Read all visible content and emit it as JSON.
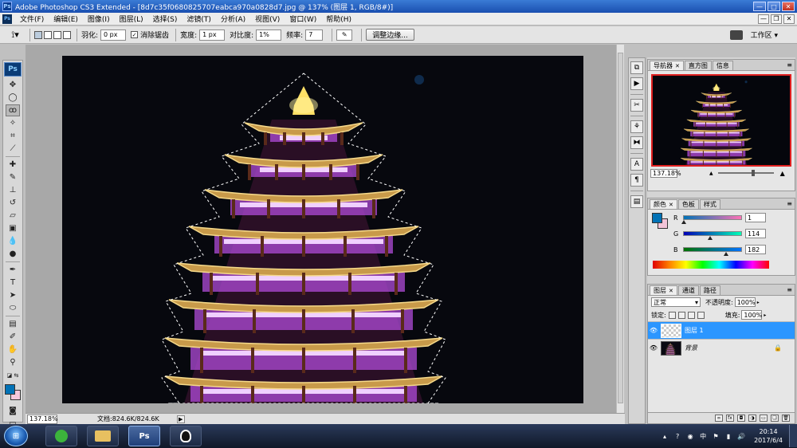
{
  "window": {
    "app_icon": "Ps",
    "title": "Adobe Photoshop CS3 Extended - [8d7c35f0680825707eabca970a0828d7.jpg @ 137% (图层 1, RGB/8#)]",
    "controls": {
      "minimize": "—",
      "maximize": "□",
      "close": "✕"
    }
  },
  "menu": {
    "items": [
      "文件(F)",
      "编辑(E)",
      "图像(I)",
      "图层(L)",
      "选择(S)",
      "滤镜(T)",
      "分析(A)",
      "视图(V)",
      "窗口(W)",
      "帮助(H)"
    ],
    "doc_controls": {
      "minimize": "—",
      "restore": "❐",
      "close": "✕"
    }
  },
  "options": {
    "feather_label": "羽化:",
    "feather_value": "0 px",
    "antialias_label": "消除锯齿",
    "antialias_checked": "✓",
    "width_label": "宽度:",
    "width_value": "1 px",
    "contrast_label": "对比度:",
    "contrast_value": "1%",
    "frequency_label": "频率:",
    "frequency_value": "7",
    "refine_edge": "调整边缘...",
    "workspace": "工作区 ▾"
  },
  "toolbox": {
    "logo": "Ps",
    "foreground_color": "#0172b6",
    "background_color": "#f4c8dc"
  },
  "document": {
    "zoom": "137.18%",
    "doc_info": "文档:824.6K/824.6K",
    "status_arrow": "▶"
  },
  "navigator": {
    "tabs": [
      "导航器",
      "直方图",
      "信息"
    ],
    "zoom": "137.18%",
    "zoom_out": "▲",
    "zoom_in": "▲"
  },
  "color": {
    "tabs": [
      "颜色",
      "色板",
      "样式"
    ],
    "channels": [
      {
        "label": "R",
        "value": "1",
        "position": 0.004
      },
      {
        "label": "G",
        "value": "114",
        "position": 0.447
      },
      {
        "label": "B",
        "value": "182",
        "position": 0.714
      }
    ],
    "foreground": "#0172b6",
    "background": "#f2c4d8"
  },
  "layers": {
    "tabs": [
      "图层",
      "通道",
      "路径"
    ],
    "blend_mode": "正常",
    "opacity_label": "不透明度:",
    "opacity_value": "100%",
    "lock_label": "锁定:",
    "fill_label": "填充:",
    "fill_value": "100%",
    "items": [
      {
        "name": "图层 1",
        "selected": true
      },
      {
        "name": "背景",
        "selected": false,
        "locked": "🔒"
      }
    ]
  },
  "taskbar": {
    "ps_button": "Ps",
    "time": "20:14",
    "date": "2017/6/4"
  },
  "selection_color": "#ffffff",
  "layer_highlight_color": "#2b96ff"
}
